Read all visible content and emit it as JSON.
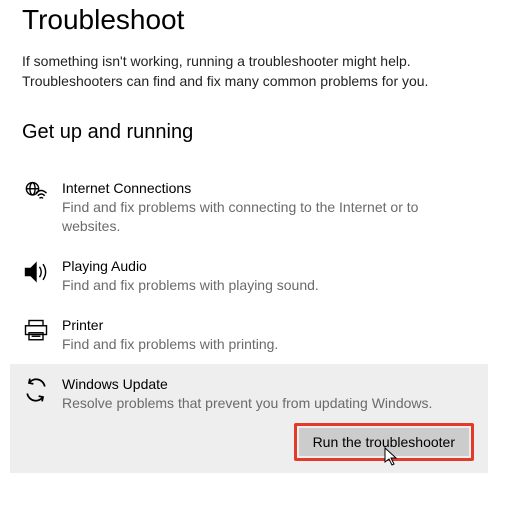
{
  "title": "Troubleshoot",
  "intro": "If something isn't working, running a troubleshooter might help. Troubleshooters can find and fix many common problems for you.",
  "section_header": "Get up and running",
  "items": [
    {
      "title": "Internet Connections",
      "desc": "Find and fix problems with connecting to the Internet or to websites."
    },
    {
      "title": "Playing Audio",
      "desc": "Find and fix problems with playing sound."
    },
    {
      "title": "Printer",
      "desc": "Find and fix problems with printing."
    },
    {
      "title": "Windows Update",
      "desc": "Resolve problems that prevent you from updating Windows."
    }
  ],
  "run_button_label": "Run the troubleshooter",
  "colors": {
    "highlight_border": "#e23b2e",
    "selected_bg": "#eeeeee",
    "desc_text": "#6a6a6a"
  }
}
